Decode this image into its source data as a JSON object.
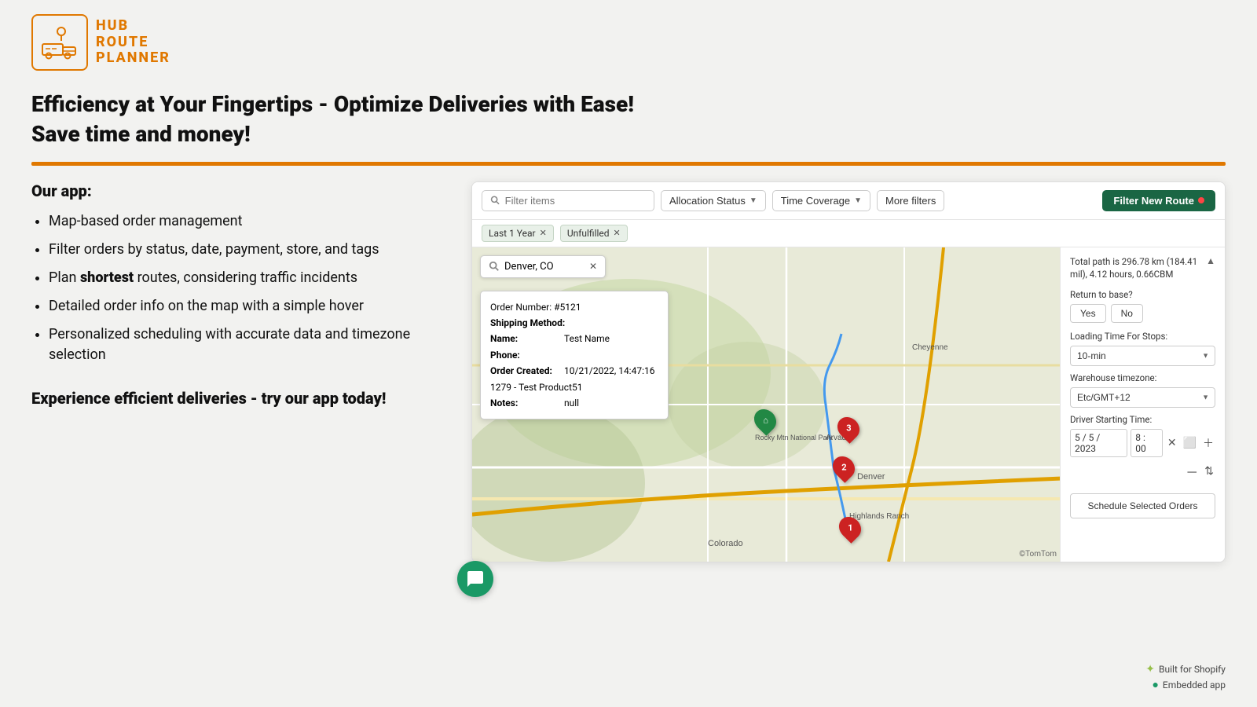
{
  "logo": {
    "line1": "HUB",
    "line2": "ROUTE",
    "line3": "PLANNER"
  },
  "headline": {
    "line1": "Efficiency at Your Fingertips - Optimize Deliveries with Ease!",
    "line2": "Save time and money!"
  },
  "left": {
    "our_app_label": "Our app:",
    "features": [
      "Map-based order management",
      "Filter orders by status, date, payment, store, and tags",
      "Plan <b>shortest</b> routes, considering traffic incidents",
      "Detailed order info on the map with a simple hover",
      "Personalized scheduling with accurate data and timezone selection"
    ],
    "cta": "Experience efficient deliveries - try our app today!"
  },
  "app": {
    "toolbar": {
      "search_placeholder": "Filter items",
      "allocation_status_label": "Allocation Status",
      "time_coverage_label": "Time Coverage",
      "more_filters_label": "More filters",
      "filter_new_route_label": "Filter New Route"
    },
    "filter_tags": [
      "Last 1 Year",
      "Unfulfilled"
    ],
    "map": {
      "search_value": "Denver, CO",
      "order_popup": {
        "order_number": "Order Number: #5121",
        "shipping_method_label": "Shipping Method:",
        "shipping_method_value": "",
        "name_label": "Name:",
        "name_value": "Test Name",
        "phone_label": "Phone:",
        "phone_value": "",
        "order_created_label": "Order Created:",
        "order_created_value": "10/21/2022, 14:47:16",
        "product": "1279 - Test Product51",
        "notes_label": "Notes:",
        "notes_value": "null"
      }
    },
    "sidebar": {
      "path_info": "Total path is 296.78 km (184.41 mil), 4.12 hours, 0.66CBM",
      "return_to_base_label": "Return to base?",
      "yes_label": "Yes",
      "no_label": "No",
      "loading_time_label": "Loading Time For Stops:",
      "loading_time_value": "10-min",
      "warehouse_tz_label": "Warehouse timezone:",
      "warehouse_tz_value": "Etc/GMT+12",
      "driver_start_label": "Driver Starting Time:",
      "driver_date": "5 / 5 / 2023",
      "driver_time": "8 : 00",
      "schedule_btn_label": "Schedule Selected Orders"
    }
  },
  "bottom_right": {
    "built_for": "Built for Shopify",
    "embedded": "Embedded app"
  }
}
